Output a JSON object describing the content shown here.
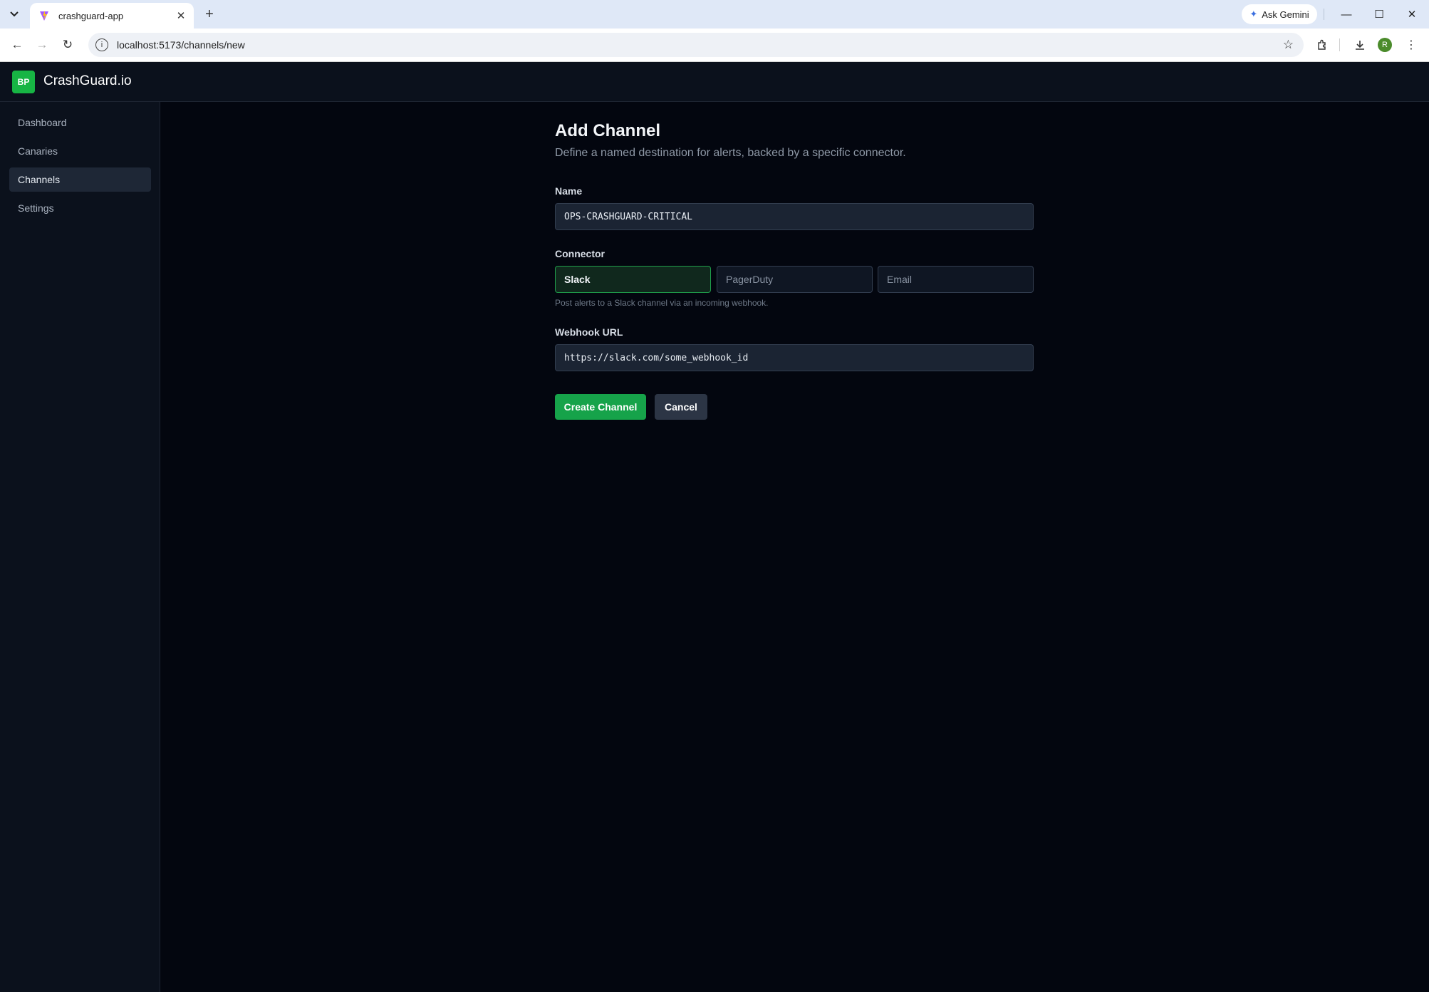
{
  "browser": {
    "tab_title": "crashguard-app",
    "url": "localhost:5173/channels/new",
    "gemini_label": "Ask Gemini",
    "profile_initial": "R"
  },
  "app": {
    "logo_text": "BP",
    "name": "CrashGuard.io",
    "accent_color": "#16a34a"
  },
  "sidebar": {
    "items": [
      {
        "label": "Dashboard",
        "active": false
      },
      {
        "label": "Canaries",
        "active": false
      },
      {
        "label": "Channels",
        "active": true
      },
      {
        "label": "Settings",
        "active": false
      }
    ]
  },
  "form": {
    "title": "Add Channel",
    "subtitle": "Define a named destination for alerts, backed by a specific connector.",
    "name_label": "Name",
    "name_value": "OPS-CRASHGUARD-CRITICAL",
    "connector_label": "Connector",
    "connectors": [
      {
        "label": "Slack",
        "selected": true
      },
      {
        "label": "PagerDuty",
        "selected": false
      },
      {
        "label": "Email",
        "selected": false
      }
    ],
    "connector_help": "Post alerts to a Slack channel via an incoming webhook.",
    "webhook_label": "Webhook URL",
    "webhook_value": "https://slack.com/some_webhook_id",
    "create_label": "Create Channel",
    "cancel_label": "Cancel"
  }
}
